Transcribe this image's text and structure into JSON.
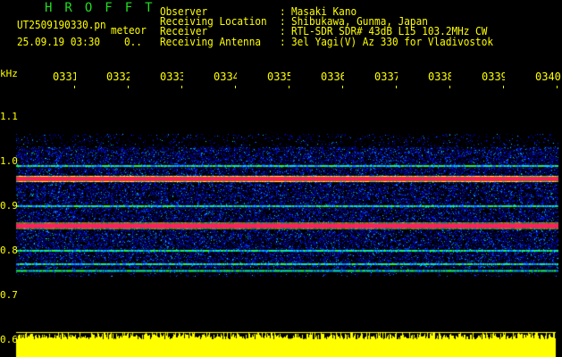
{
  "header": {
    "title": "HROFFT",
    "filename": "UT2509190330.pn",
    "mode": "meteor",
    "datetime": "25.09.19 03:30",
    "count": "0..",
    "info_labels": [
      "Observer",
      "Receiving Location",
      "Receiver",
      "Receiving Antenna"
    ],
    "info_values": [
      "Masaki Kano",
      "Shibukawa, Gunma, Japan",
      "RTL-SDR SDR# 43dB L15 103.2MHz CW",
      "3el Yagi(V) Az 330 for Vladivostok"
    ]
  },
  "axis": {
    "y_unit": "kHz",
    "y_ticks": [
      "1.1",
      "1.0",
      "0.9",
      "0.8",
      "0.7",
      "0.6"
    ],
    "time_ticks": [
      "0331",
      "0332",
      "0333",
      "0334",
      "0335",
      "0336",
      "0337",
      "0338",
      "0339",
      "0340"
    ]
  },
  "spectrogram": {
    "strong_lines_khz": [
      0.96,
      0.855
    ],
    "weak_lines_khz": [
      0.99,
      0.9,
      0.8,
      0.77,
      0.755
    ],
    "colors": {
      "background": "#000000",
      "text": "#ffff00",
      "title": "#22dd22",
      "strong": "#ff2060",
      "level_bar": "#ffff00"
    }
  }
}
